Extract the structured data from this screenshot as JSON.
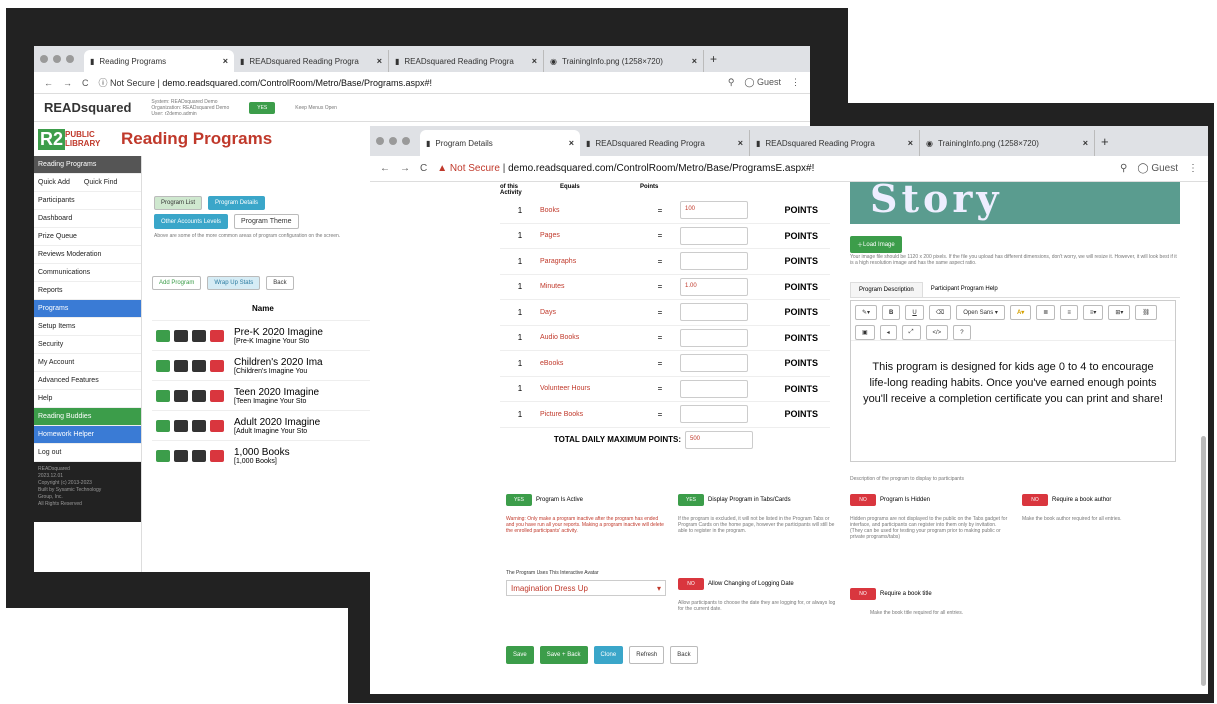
{
  "back_window": {
    "tabs": [
      "Reading Programs",
      "READsquared Reading Progra",
      "READsquared Reading Progra",
      "TrainingInfo.png (1258×720)"
    ],
    "url_prefix": "Not Secure",
    "url": "demo.readsquared.com/ControlRoom/Metro/Base/Programs.aspx#!",
    "guest": "Guest",
    "brand": "READsquared",
    "system_info": "System: READsquared Demo\nOrganization: READsquared Demo\nUser: r2demo.admin",
    "keep_menus": "Keep Menus Open",
    "library_logo_left": "R2",
    "library_logo_right": "PUBLIC LIBRARY",
    "page_title": "Reading Programs",
    "sidebar": [
      "Reading Programs",
      "Quick Add",
      "Quick Find",
      "Participants",
      "Dashboard",
      "Prize Queue",
      "Reviews Moderation",
      "Communications",
      "Reports",
      "Programs",
      "Setup Items",
      "Security",
      "My Account",
      "Advanced Features",
      "Help",
      "Reading Buddies",
      "Homework Helper",
      "Log out"
    ],
    "sidebar_footer": "READsquared\n2023.12.01\nCopyright (c) 2013-2023\nBuilt by Sysamic Technology\nGroup, Inc.\nAll Rights Reserved",
    "buttons": [
      "Program List",
      "Program Details",
      "Other Accounts Levels",
      "Program Theme"
    ],
    "note": "Above are some of the more common areas of program configuration on the screen.",
    "actions": [
      "Add Program",
      "Wrap Up Stats",
      "Back"
    ],
    "name_header": "Name",
    "programs": [
      {
        "name": "Pre-K 2020 Imagine",
        "sub": "[Pre-K Imagine Your Sto"
      },
      {
        "name": "Children's 2020 Ima",
        "sub": "[Children's Imagine You"
      },
      {
        "name": "Teen 2020 Imagine",
        "sub": "[Teen Imagine Your Sto"
      },
      {
        "name": "Adult 2020 Imagine",
        "sub": "[Adult Imagine Your Sto"
      },
      {
        "name": "1,000 Books",
        "sub": "[1,000 Books]"
      }
    ]
  },
  "front_window": {
    "tabs": [
      "Program Details",
      "READsquared Reading Progra",
      "READsquared Reading Progra",
      "TrainingInfo.png (1258×720)"
    ],
    "url_prefix": "Not Secure",
    "url": "demo.readsquared.com/ControlRoom/Metro/Base/ProgramsE.aspx#!",
    "guest": "Guest",
    "col_headers": [
      "of this Activity",
      "Equals",
      "Points"
    ],
    "rows": [
      {
        "qty": "1",
        "unit": "Books",
        "eq": "=",
        "val": "100",
        "pts": "POINTS"
      },
      {
        "qty": "1",
        "unit": "Pages",
        "eq": "=",
        "val": "",
        "pts": "POINTS"
      },
      {
        "qty": "1",
        "unit": "Paragraphs",
        "eq": "=",
        "val": "",
        "pts": "POINTS"
      },
      {
        "qty": "1",
        "unit": "Minutes",
        "eq": "=",
        "val": "1.00",
        "pts": "POINTS"
      },
      {
        "qty": "1",
        "unit": "Days",
        "eq": "=",
        "val": "",
        "pts": "POINTS"
      },
      {
        "qty": "1",
        "unit": "Audio Books",
        "eq": "=",
        "val": "",
        "pts": "POINTS"
      },
      {
        "qty": "1",
        "unit": "eBooks",
        "eq": "=",
        "val": "",
        "pts": "POINTS"
      },
      {
        "qty": "1",
        "unit": "Volunteer Hours",
        "eq": "=",
        "val": "",
        "pts": "POINTS"
      },
      {
        "qty": "1",
        "unit": "Picture Books",
        "eq": "=",
        "val": "",
        "pts": "POINTS"
      }
    ],
    "total_label": "TOTAL DAILY MAXIMUM POINTS:",
    "total_value": "500",
    "banner_text": "Story",
    "load_image": "Load Image",
    "image_note": "Your image file should be 1120 x 200 pixels. If the file you upload has different dimensions, don't worry, we will resize it. However, it will look best if it is a high resolution image and has the same aspect ratio.",
    "desc_tabs": [
      "Program Description",
      "Participant Program Help"
    ],
    "font_select": "Open Sans",
    "description": "This program is designed for kids age 0 to 4 to encourage life-long reading habits. Once you've earned enough points you'll receive a completion certificate you can print and share!",
    "desc_caption": "Description of the program to display to participants",
    "toggles": [
      {
        "state": "YES",
        "label": "Program Is Active",
        "help": "Warning: Only make a program inactive after the program has ended and you have run all your reports. Making a program inactive will delete the enrolled participants' activity."
      },
      {
        "state": "YES",
        "label": "Display Program in Tabs/Cards",
        "help": "If the program is excluded, it will not be listed in the Program Tabs or Program Cards on the home page, however the participants will still be able to register in the program."
      },
      {
        "state": "NO",
        "label": "Program Is Hidden",
        "help": "Hidden programs are not displayed to the public on the Tabs gadget for interface, and participants can register into them only by invitation. (They can be used for testing your program prior to making public or private programs/tabs)"
      },
      {
        "state": "NO",
        "label": "Require a book author",
        "help": "Make the book author required for all entries."
      }
    ],
    "avatar_label": "The Program Uses This Interactive Avatar",
    "avatar_value": "Imagination Dress Up",
    "logging_toggle": {
      "state": "NO",
      "label": "Allow Changing of Logging Date",
      "help": "Allow participants to choose the date they are logging for, or always log for the current date."
    },
    "title_toggle": {
      "state": "NO",
      "label": "Require a book title",
      "help": "Make the book title required for all entries."
    },
    "bottom_buttons": [
      "Save",
      "Save + Back",
      "Clone",
      "Refresh",
      "Back"
    ]
  }
}
